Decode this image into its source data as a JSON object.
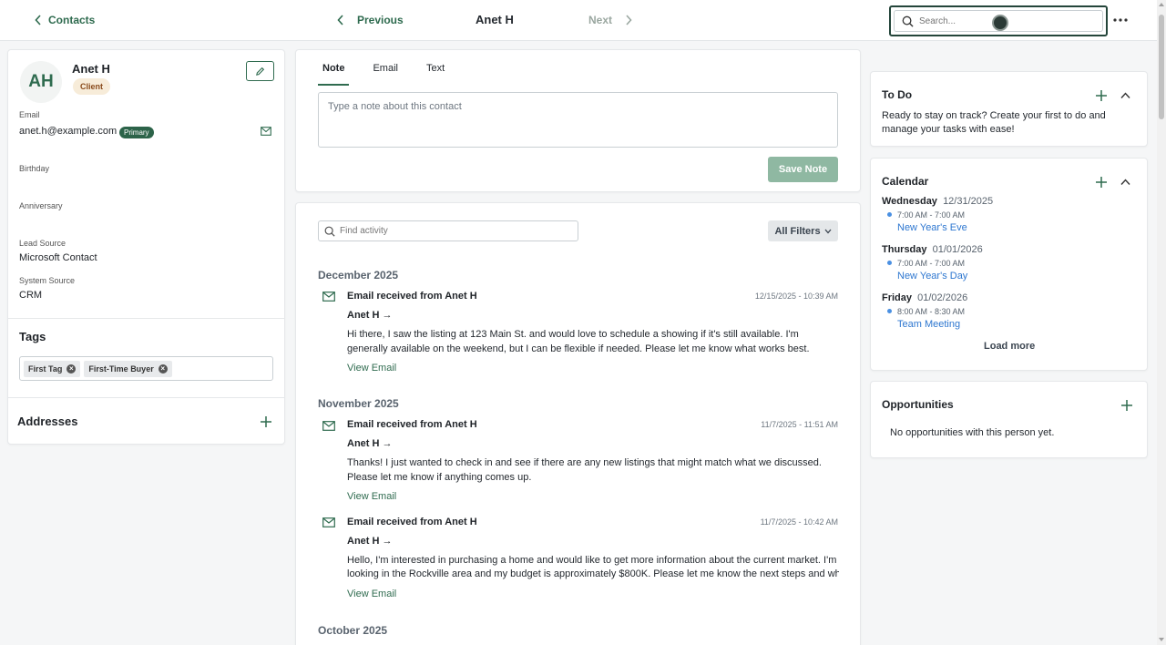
{
  "header": {
    "back_label": "Contacts",
    "previous_label": "Previous",
    "contact_name": "Anet H",
    "next_label": "Next",
    "search_placeholder": "Search..."
  },
  "contact": {
    "initials": "AH",
    "name": "Anet H",
    "badge": "Client",
    "email_label": "Email",
    "email_value": "anet.h@example.com",
    "email_primary_badge": "Primary",
    "birthday_label": "Birthday",
    "anniversary_label": "Anniversary",
    "lead_source_label": "Lead Source",
    "lead_source_value": "Microsoft Contact",
    "system_source_label": "System Source",
    "system_source_value": "CRM"
  },
  "tags": {
    "title": "Tags",
    "items": [
      "First Tag",
      "First-Time Buyer"
    ]
  },
  "addresses": {
    "title": "Addresses"
  },
  "composer": {
    "tabs": [
      "Note",
      "Email",
      "Text"
    ],
    "active_tab": "Note",
    "placeholder": "Type a note about this contact",
    "save_label": "Save Note"
  },
  "activity": {
    "find_placeholder": "Find activity",
    "filters_label": "All Filters",
    "groups": [
      {
        "month": "December 2025",
        "items": [
          {
            "title": "Email received from Anet H",
            "date": "12/15/2025 - 10:39 AM",
            "from": "Anet H →",
            "body": "Hi there, I saw the listing at 123 Main St. and would love to schedule a showing if it's still available. I'm generally available on the weekend, but I can be flexible if needed. Please let me know what works best.",
            "link": "View Email"
          }
        ]
      },
      {
        "month": "November 2025",
        "items": [
          {
            "title": "Email received from Anet H",
            "date": "11/7/2025 - 11:51 AM",
            "from": "Anet H →",
            "body": "Thanks! I just wanted to check in and see if there are any new listings that might match what we discussed. Please let me know if anything comes up.",
            "link": "View Email"
          },
          {
            "title": "Email received from Anet H",
            "date": "11/7/2025 - 10:42 AM",
            "from": "Anet H →",
            "body_line1": "Hello, I'm interested in purchasing a home and would like to get more information about the current market. I'm",
            "body_line2": "looking in the Rockville area and my budget is approximately $800K. Please let me know the next steps and wh…",
            "link": "View Email"
          }
        ]
      },
      {
        "month": "October 2025"
      }
    ]
  },
  "todo": {
    "title": "To Do",
    "text": "Ready to stay on track? Create your first to do and manage your tasks with ease!"
  },
  "calendar": {
    "title": "Calendar",
    "days": [
      {
        "weekday": "Wednesday",
        "date": "12/31/2025",
        "time": "7:00 AM - 7:00 AM",
        "event": "New Year's Eve"
      },
      {
        "weekday": "Thursday",
        "date": "01/01/2026",
        "time": "7:00 AM - 7:00 AM",
        "event": "New Year's Day"
      },
      {
        "weekday": "Friday",
        "date": "01/02/2026",
        "time": "8:00 AM - 8:30 AM",
        "event": "Team Meeting"
      }
    ],
    "load_more": "Load more"
  },
  "opportunities": {
    "title": "Opportunities",
    "empty_text": "No opportunities with this person yet."
  },
  "colors": {
    "accent": "#2f6b4f",
    "primary_badge": "#2c6349",
    "client_badge_bg": "#f7ecd9",
    "event_link": "#2e77d0",
    "save_button_disabled": "#8fb8a2"
  }
}
